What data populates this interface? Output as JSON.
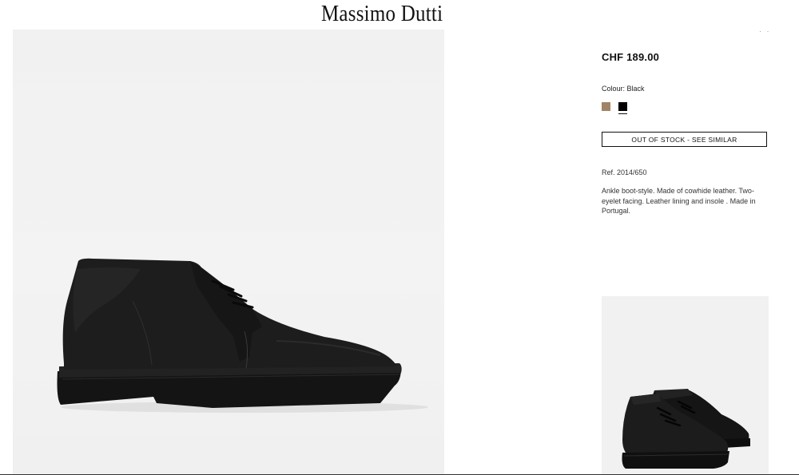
{
  "header": {
    "brand": "Massimo Dutti"
  },
  "product": {
    "price": "CHF 189.00",
    "colour_label": "Colour:",
    "colour_value": "Black",
    "swatches": [
      {
        "name": "Brown",
        "color": "#a08466",
        "selected": false
      },
      {
        "name": "Black",
        "color": "#000000",
        "selected": true
      }
    ],
    "stock_button": "OUT OF STOCK - SEE SIMILAR",
    "reference": "Ref. 2014/650",
    "description": "Ankle boot-style. Made of cowhide leather. Two-eyelet facing. Leather lining and insole . Made in Portugal."
  },
  "gallery": {
    "main_image": "black-leather-ankle-boot-side-view",
    "thumbnail": "black-leather-ankle-boots-pair-view"
  },
  "colors": {
    "background": "#ffffff",
    "image_background": "#f1f1f1",
    "text": "#111111"
  }
}
